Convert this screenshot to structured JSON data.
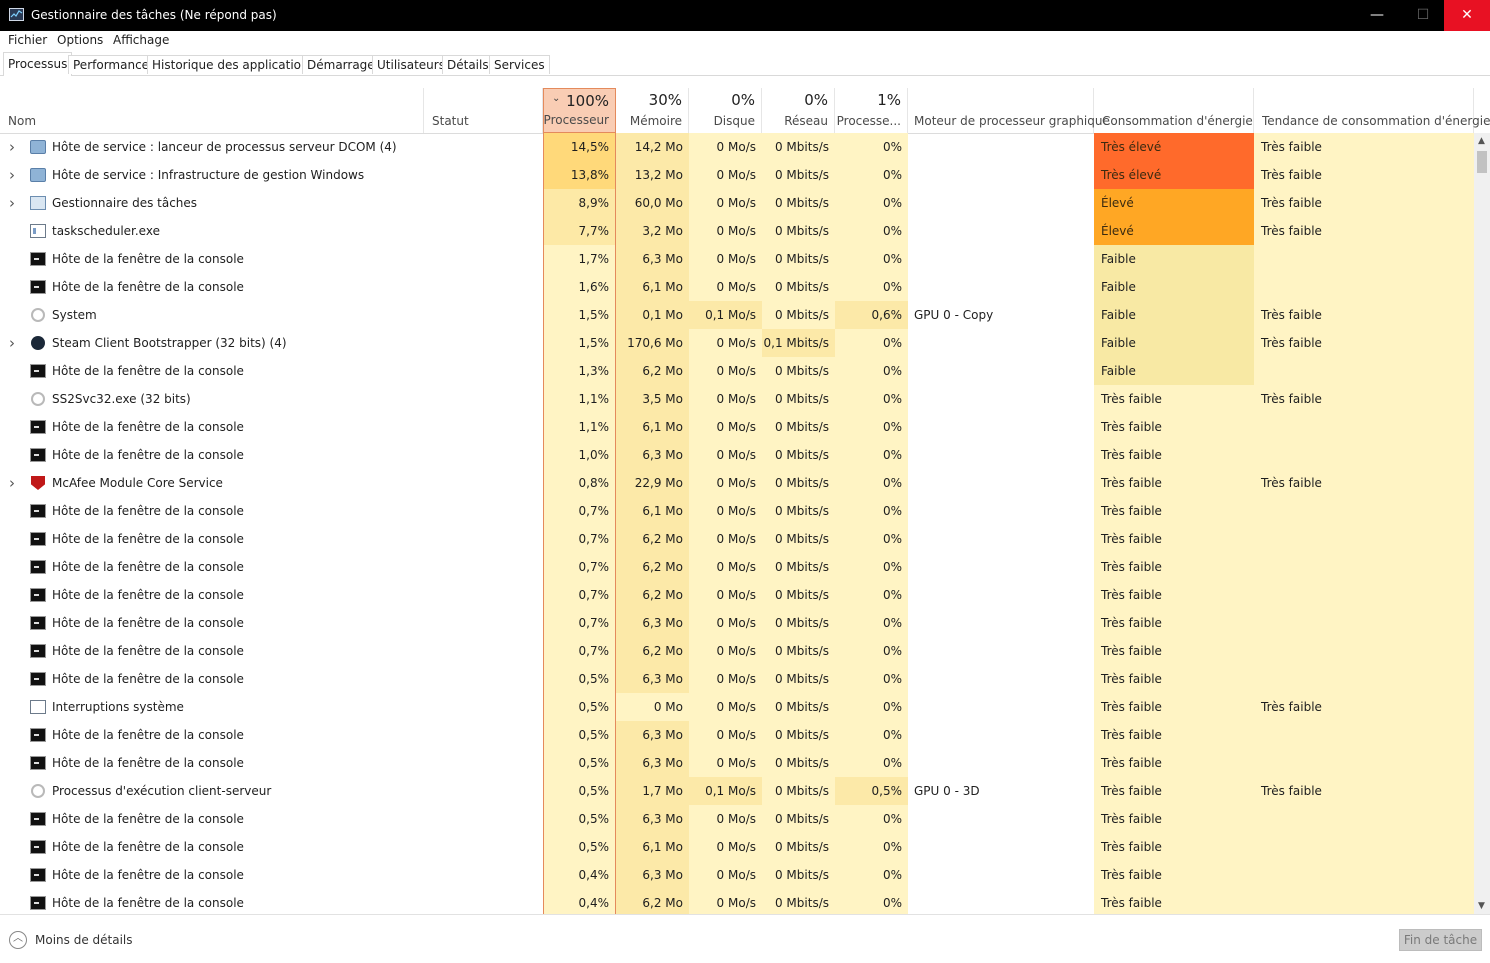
{
  "window": {
    "title": "Gestionnaire des tâches (Ne répond pas)",
    "min": "—",
    "max": "☐",
    "close": "✕"
  },
  "menu": [
    "Fichier",
    "Options",
    "Affichage"
  ],
  "tabs": [
    "Processus",
    "Performance",
    "Historique des applications",
    "Démarrage",
    "Utilisateurs",
    "Détails",
    "Services"
  ],
  "columns": {
    "name": "Nom",
    "status": "Statut",
    "cpu": {
      "pct": "100%",
      "label": "Processeur"
    },
    "mem": {
      "pct": "30%",
      "label": "Mémoire"
    },
    "disk": {
      "pct": "0%",
      "label": "Disque"
    },
    "net": {
      "pct": "0%",
      "label": "Réseau"
    },
    "gpu": {
      "pct": "1%",
      "label": "Processe..."
    },
    "gpuengine": "Moteur de processeur graphique",
    "power": "Consommation d'énergie",
    "powertrend": "Tendance de consommation d'énergie"
  },
  "colors": {
    "veryhigh": "#ff6a2b",
    "high": "#ffa724",
    "low": "#f8e9a4",
    "verylow": "#fff4c4",
    "cpu_hot": "#ffd97a",
    "cpu_warm": "#fde9a6",
    "mem_warm": "#fce9a8",
    "base": "#fff4c4"
  },
  "rows": [
    {
      "expand": true,
      "icon": "service",
      "name": "Hôte de service : lanceur de processus serveur DCOM (4)",
      "cpu": "14,5%",
      "mem": "14,2 Mo",
      "disk": "0 Mo/s",
      "net": "0 Mbits/s",
      "gpu": "0%",
      "engine": "",
      "power": "Très élevé",
      "ptype": "veryhigh",
      "trend": "Très faible"
    },
    {
      "expand": true,
      "icon": "service",
      "name": "Hôte de service : Infrastructure de gestion Windows",
      "cpu": "13,8%",
      "mem": "13,2 Mo",
      "disk": "0 Mo/s",
      "net": "0 Mbits/s",
      "gpu": "0%",
      "engine": "",
      "power": "Très élevé",
      "ptype": "veryhigh",
      "trend": "Très faible"
    },
    {
      "expand": true,
      "icon": "taskmgr",
      "name": "Gestionnaire des tâches",
      "cpu": "8,9%",
      "mem": "60,0 Mo",
      "disk": "0 Mo/s",
      "net": "0 Mbits/s",
      "gpu": "0%",
      "engine": "",
      "power": "Élevé",
      "ptype": "high",
      "trend": "Très faible"
    },
    {
      "expand": false,
      "icon": "window",
      "name": "taskscheduler.exe",
      "cpu": "7,7%",
      "mem": "3,2 Mo",
      "disk": "0 Mo/s",
      "net": "0 Mbits/s",
      "gpu": "0%",
      "engine": "",
      "power": "Élevé",
      "ptype": "high",
      "trend": "Très faible"
    },
    {
      "expand": false,
      "icon": "console",
      "name": "Hôte de la fenêtre de la console",
      "cpu": "1,7%",
      "mem": "6,3 Mo",
      "disk": "0 Mo/s",
      "net": "0 Mbits/s",
      "gpu": "0%",
      "engine": "",
      "power": "Faible",
      "ptype": "low",
      "trend": ""
    },
    {
      "expand": false,
      "icon": "console",
      "name": "Hôte de la fenêtre de la console",
      "cpu": "1,6%",
      "mem": "6,1 Mo",
      "disk": "0 Mo/s",
      "net": "0 Mbits/s",
      "gpu": "0%",
      "engine": "",
      "power": "Faible",
      "ptype": "low",
      "trend": ""
    },
    {
      "expand": false,
      "icon": "gear",
      "name": "System",
      "cpu": "1,5%",
      "mem": "0,1 Mo",
      "disk": "0,1 Mo/s",
      "net": "0 Mbits/s",
      "gpu": "0,6%",
      "engine": "GPU 0 - Copy",
      "power": "Faible",
      "ptype": "low",
      "trend": "Très faible",
      "diskhl": true,
      "gpuhl": true
    },
    {
      "expand": true,
      "icon": "steam",
      "name": "Steam Client Bootstrapper (32 bits) (4)",
      "cpu": "1,5%",
      "mem": "170,6 Mo",
      "disk": "0 Mo/s",
      "net": "0,1 Mbits/s",
      "gpu": "0%",
      "engine": "",
      "power": "Faible",
      "ptype": "low",
      "trend": "Très faible",
      "nethl": true
    },
    {
      "expand": false,
      "icon": "console",
      "name": "Hôte de la fenêtre de la console",
      "cpu": "1,3%",
      "mem": "6,2 Mo",
      "disk": "0 Mo/s",
      "net": "0 Mbits/s",
      "gpu": "0%",
      "engine": "",
      "power": "Faible",
      "ptype": "low",
      "trend": ""
    },
    {
      "expand": false,
      "icon": "gear",
      "name": "SS2Svc32.exe (32 bits)",
      "cpu": "1,1%",
      "mem": "3,5 Mo",
      "disk": "0 Mo/s",
      "net": "0 Mbits/s",
      "gpu": "0%",
      "engine": "",
      "power": "Très faible",
      "ptype": "verylow",
      "trend": "Très faible"
    },
    {
      "expand": false,
      "icon": "console",
      "name": "Hôte de la fenêtre de la console",
      "cpu": "1,1%",
      "mem": "6,1 Mo",
      "disk": "0 Mo/s",
      "net": "0 Mbits/s",
      "gpu": "0%",
      "engine": "",
      "power": "Très faible",
      "ptype": "verylow",
      "trend": ""
    },
    {
      "expand": false,
      "icon": "console",
      "name": "Hôte de la fenêtre de la console",
      "cpu": "1,0%",
      "mem": "6,3 Mo",
      "disk": "0 Mo/s",
      "net": "0 Mbits/s",
      "gpu": "0%",
      "engine": "",
      "power": "Très faible",
      "ptype": "verylow",
      "trend": ""
    },
    {
      "expand": true,
      "icon": "mcafee",
      "name": "McAfee Module Core Service",
      "cpu": "0,8%",
      "mem": "22,9 Mo",
      "disk": "0 Mo/s",
      "net": "0 Mbits/s",
      "gpu": "0%",
      "engine": "",
      "power": "Très faible",
      "ptype": "verylow",
      "trend": "Très faible"
    },
    {
      "expand": false,
      "icon": "console",
      "name": "Hôte de la fenêtre de la console",
      "cpu": "0,7%",
      "mem": "6,1 Mo",
      "disk": "0 Mo/s",
      "net": "0 Mbits/s",
      "gpu": "0%",
      "engine": "",
      "power": "Très faible",
      "ptype": "verylow",
      "trend": ""
    },
    {
      "expand": false,
      "icon": "console",
      "name": "Hôte de la fenêtre de la console",
      "cpu": "0,7%",
      "mem": "6,2 Mo",
      "disk": "0 Mo/s",
      "net": "0 Mbits/s",
      "gpu": "0%",
      "engine": "",
      "power": "Très faible",
      "ptype": "verylow",
      "trend": ""
    },
    {
      "expand": false,
      "icon": "console",
      "name": "Hôte de la fenêtre de la console",
      "cpu": "0,7%",
      "mem": "6,2 Mo",
      "disk": "0 Mo/s",
      "net": "0 Mbits/s",
      "gpu": "0%",
      "engine": "",
      "power": "Très faible",
      "ptype": "verylow",
      "trend": ""
    },
    {
      "expand": false,
      "icon": "console",
      "name": "Hôte de la fenêtre de la console",
      "cpu": "0,7%",
      "mem": "6,2 Mo",
      "disk": "0 Mo/s",
      "net": "0 Mbits/s",
      "gpu": "0%",
      "engine": "",
      "power": "Très faible",
      "ptype": "verylow",
      "trend": ""
    },
    {
      "expand": false,
      "icon": "console",
      "name": "Hôte de la fenêtre de la console",
      "cpu": "0,7%",
      "mem": "6,3 Mo",
      "disk": "0 Mo/s",
      "net": "0 Mbits/s",
      "gpu": "0%",
      "engine": "",
      "power": "Très faible",
      "ptype": "verylow",
      "trend": ""
    },
    {
      "expand": false,
      "icon": "console",
      "name": "Hôte de la fenêtre de la console",
      "cpu": "0,7%",
      "mem": "6,2 Mo",
      "disk": "0 Mo/s",
      "net": "0 Mbits/s",
      "gpu": "0%",
      "engine": "",
      "power": "Très faible",
      "ptype": "verylow",
      "trend": ""
    },
    {
      "expand": false,
      "icon": "console",
      "name": "Hôte de la fenêtre de la console",
      "cpu": "0,5%",
      "mem": "6,3 Mo",
      "disk": "0 Mo/s",
      "net": "0 Mbits/s",
      "gpu": "0%",
      "engine": "",
      "power": "Très faible",
      "ptype": "verylow",
      "trend": ""
    },
    {
      "expand": false,
      "icon": "interrupt",
      "name": "Interruptions système",
      "cpu": "0,5%",
      "mem": "0 Mo",
      "disk": "0 Mo/s",
      "net": "0 Mbits/s",
      "gpu": "0%",
      "engine": "",
      "power": "Très faible",
      "ptype": "verylow",
      "trend": "Très faible",
      "memlow": true
    },
    {
      "expand": false,
      "icon": "console",
      "name": "Hôte de la fenêtre de la console",
      "cpu": "0,5%",
      "mem": "6,3 Mo",
      "disk": "0 Mo/s",
      "net": "0 Mbits/s",
      "gpu": "0%",
      "engine": "",
      "power": "Très faible",
      "ptype": "verylow",
      "trend": ""
    },
    {
      "expand": false,
      "icon": "console",
      "name": "Hôte de la fenêtre de la console",
      "cpu": "0,5%",
      "mem": "6,3 Mo",
      "disk": "0 Mo/s",
      "net": "0 Mbits/s",
      "gpu": "0%",
      "engine": "",
      "power": "Très faible",
      "ptype": "verylow",
      "trend": ""
    },
    {
      "expand": false,
      "icon": "gear",
      "name": "Processus d'exécution client-serveur",
      "cpu": "0,5%",
      "mem": "1,7 Mo",
      "disk": "0,1 Mo/s",
      "net": "0 Mbits/s",
      "gpu": "0,5%",
      "engine": "GPU 0 - 3D",
      "power": "Très faible",
      "ptype": "verylow",
      "trend": "Très faible",
      "diskhl": true,
      "gpuhl": true
    },
    {
      "expand": false,
      "icon": "console",
      "name": "Hôte de la fenêtre de la console",
      "cpu": "0,5%",
      "mem": "6,3 Mo",
      "disk": "0 Mo/s",
      "net": "0 Mbits/s",
      "gpu": "0%",
      "engine": "",
      "power": "Très faible",
      "ptype": "verylow",
      "trend": ""
    },
    {
      "expand": false,
      "icon": "console",
      "name": "Hôte de la fenêtre de la console",
      "cpu": "0,5%",
      "mem": "6,1 Mo",
      "disk": "0 Mo/s",
      "net": "0 Mbits/s",
      "gpu": "0%",
      "engine": "",
      "power": "Très faible",
      "ptype": "verylow",
      "trend": ""
    },
    {
      "expand": false,
      "icon": "console",
      "name": "Hôte de la fenêtre de la console",
      "cpu": "0,4%",
      "mem": "6,3 Mo",
      "disk": "0 Mo/s",
      "net": "0 Mbits/s",
      "gpu": "0%",
      "engine": "",
      "power": "Très faible",
      "ptype": "verylow",
      "trend": ""
    },
    {
      "expand": false,
      "icon": "console",
      "name": "Hôte de la fenêtre de la console",
      "cpu": "0,4%",
      "mem": "6,2 Mo",
      "disk": "0 Mo/s",
      "net": "0 Mbits/s",
      "gpu": "0%",
      "engine": "",
      "power": "Très faible",
      "ptype": "verylow",
      "trend": ""
    }
  ],
  "footer": {
    "less": "Moins de détails",
    "endtask": "Fin de tâche"
  }
}
